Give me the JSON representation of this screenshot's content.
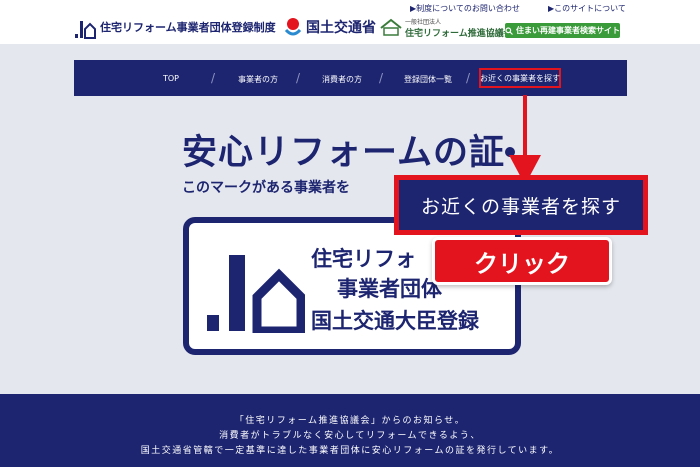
{
  "header": {
    "site_title": "住宅リフォーム事業者団体登録制度",
    "mlit_name": "国土交通省",
    "association_subtitle": "一般社団法人",
    "association_name": "住宅リフォーム推進協議会",
    "search_site_button": "住まい再建事業者検索サイト",
    "links": {
      "contact": "▶制度についてのお問い合わせ",
      "about": "▶このサイトについて"
    }
  },
  "nav": {
    "items": [
      "TOP",
      "事業者の方",
      "消費者の方",
      "登録団体一覧",
      "お近くの事業者を探す"
    ],
    "separator": "/"
  },
  "hero": {
    "title": "安心リフォームの証",
    "subtitle": "このマークがある事業者を"
  },
  "cert_mark": {
    "line1": "住宅リフォ",
    "line2": "事業者団体",
    "line3": "国土交通大臣登録"
  },
  "callout": {
    "label": "お近くの事業者を探す",
    "action": "クリック"
  },
  "notice": {
    "line1": "「住宅リフォーム推進協議会」からのお知らせ。",
    "line2": "消費者がトラブルなく安心してリフォームできるよう、",
    "line3": "国土交通省管轄で一定基準に達した事業者団体に安心リフォームの証を発行しています。"
  },
  "colors": {
    "navy": "#1d2570",
    "highlight_red": "#e4141e",
    "green_button": "#3a9b3a",
    "background": "#e4e7ee"
  },
  "icons": [
    "house-logo-icon",
    "mlit-emblem-icon",
    "association-logo-icon",
    "search-icon",
    "callout-arrow-icon"
  ]
}
